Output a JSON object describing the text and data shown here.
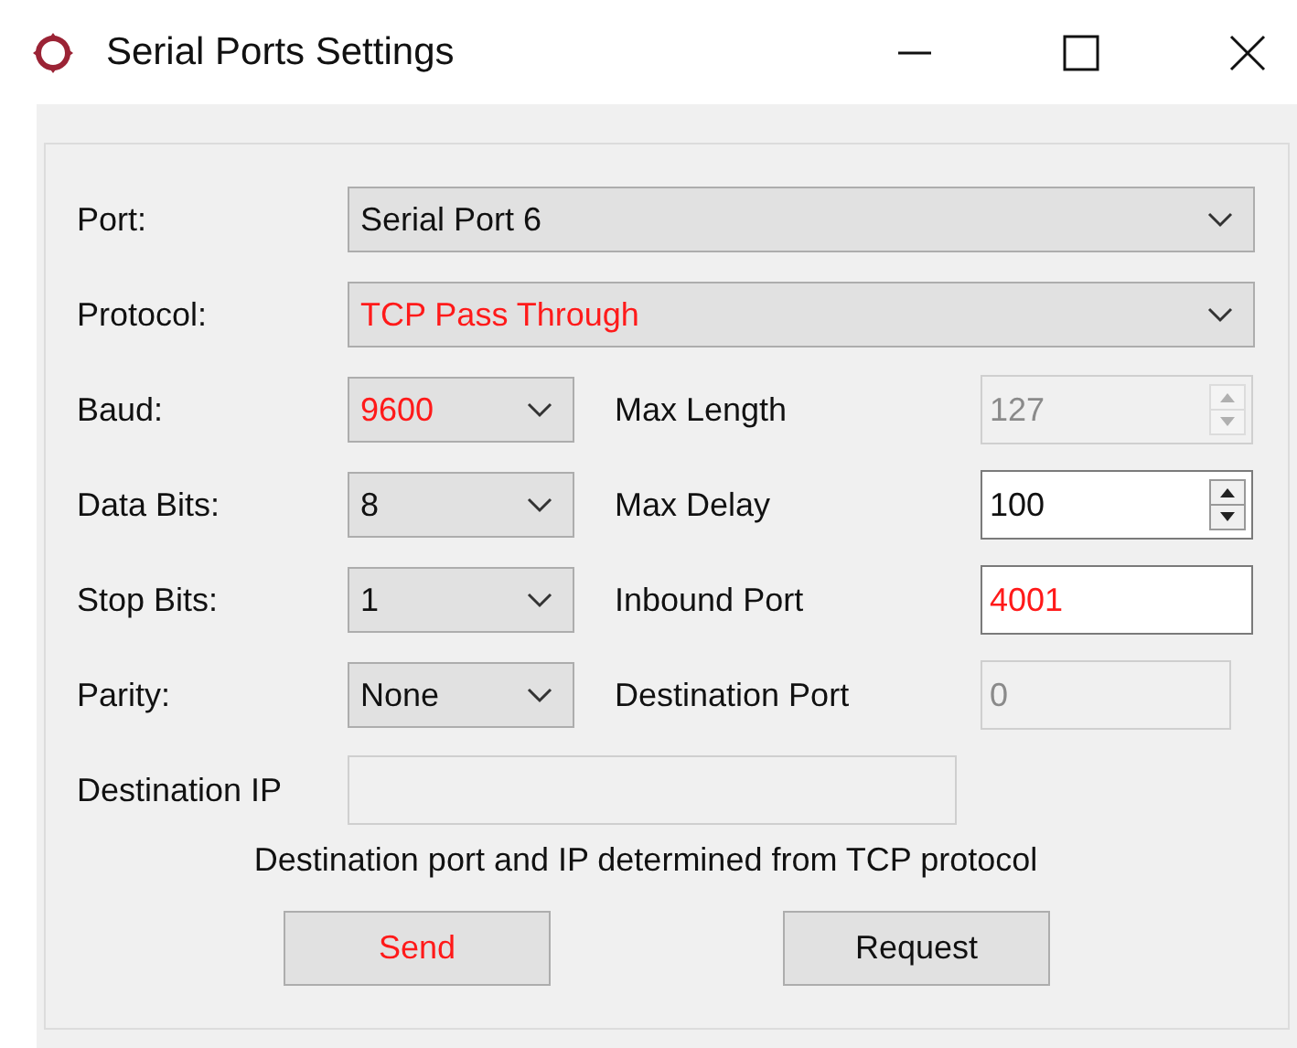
{
  "window": {
    "title": "Serial Ports Settings"
  },
  "port": {
    "label": "Port:",
    "value": "Serial Port 6",
    "modified": false
  },
  "protocol": {
    "label": "Protocol:",
    "value": "TCP Pass Through",
    "modified": true
  },
  "rows": [
    {
      "left": {
        "label": "Baud:",
        "value": "9600",
        "modified": true
      },
      "right": {
        "label": "Max Length",
        "value": "127",
        "kind": "spin",
        "disabled": true
      }
    },
    {
      "left": {
        "label": "Data Bits:",
        "value": "8",
        "modified": false
      },
      "right": {
        "label": "Max Delay",
        "value": "100",
        "kind": "spin",
        "disabled": false,
        "modified": false
      }
    },
    {
      "left": {
        "label": "Stop Bits:",
        "value": "1",
        "modified": false
      },
      "right": {
        "label": "Inbound Port",
        "value": "4001",
        "kind": "text",
        "disabled": false,
        "modified": true
      }
    },
    {
      "left": {
        "label": "Parity:",
        "value": "None",
        "modified": false
      },
      "right": {
        "label": "Destination Port",
        "value": "0",
        "kind": "text",
        "disabled": true
      }
    }
  ],
  "destination_ip": {
    "label": "Destination IP",
    "disabled": true
  },
  "note": "Destination port and IP determined from TCP protocol",
  "buttons": [
    {
      "label": "Send",
      "modified": true
    },
    {
      "label": "Request",
      "modified": false
    }
  ]
}
